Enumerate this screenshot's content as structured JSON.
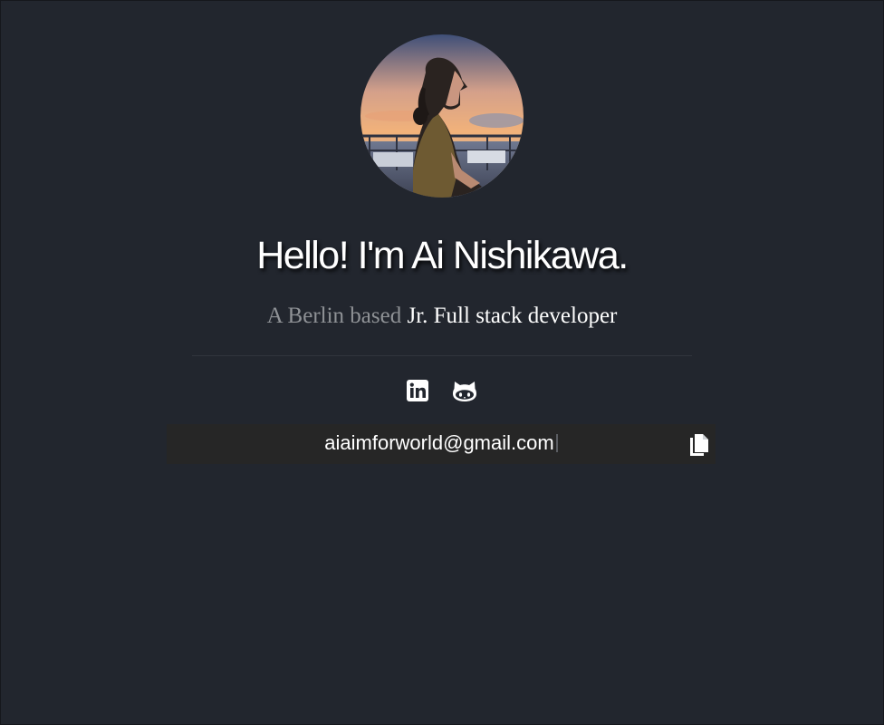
{
  "profile": {
    "title": "Hello! I'm Ai Nishikawa.",
    "subtitle_muted": "A Berlin based",
    "subtitle_strong": "Jr. Full stack developer"
  },
  "social": {
    "linkedin_icon": "linkedin-icon",
    "github_icon": "github-octocat-icon"
  },
  "contact": {
    "email": "aiaimforworld@gmail.com",
    "copy_icon": "copy-icon"
  },
  "colors": {
    "background": "#22262e",
    "email_bar": "#262626",
    "muted_text": "#8f9296",
    "text": "#ffffff"
  }
}
